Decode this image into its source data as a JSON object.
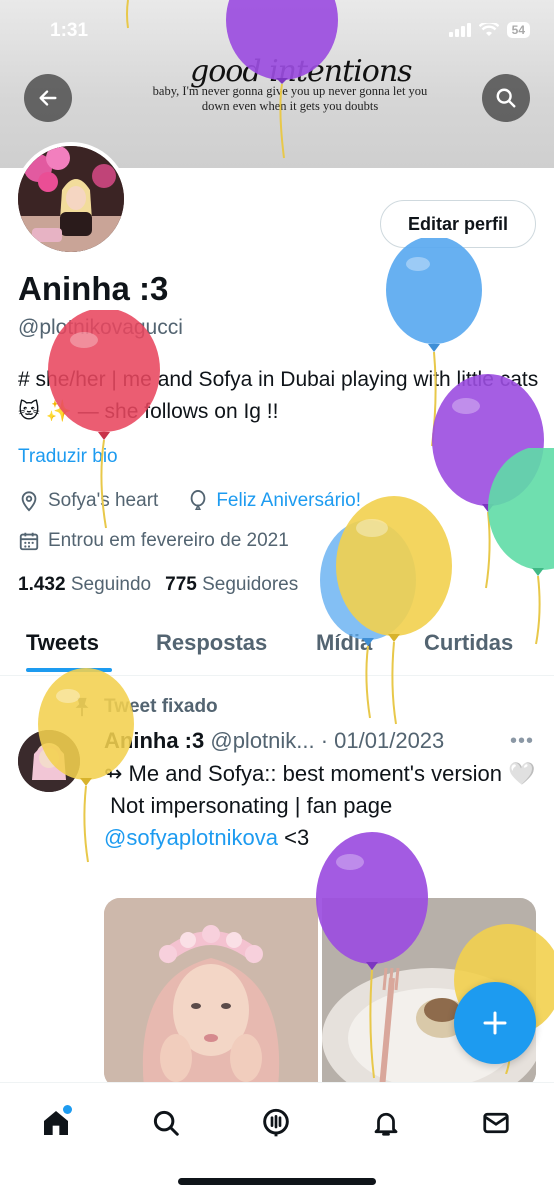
{
  "status_bar": {
    "time": "1:31",
    "battery": "54"
  },
  "banner": {
    "script_text": "good intentions",
    "lyric": "baby, I'm never gonna give you up never gonna let you down even when it gets you doubts"
  },
  "profile": {
    "edit_button": "Editar perfil",
    "name": "Aninha :3",
    "handle": "@plotnikovagucci",
    "bio": "# she/her | me and Sofya in Dubai playing with little cats 🐱 ✨ — she follows on Ig !!",
    "translate": "Traduzir bio",
    "location": "Sofya's heart",
    "birthday": "Feliz Aniversário!",
    "joined": "Entrou em fevereiro de 2021",
    "following_count": "1.432",
    "following_label": "Seguindo",
    "followers_count": "775",
    "followers_label": "Seguidores"
  },
  "tabs": [
    "Tweets",
    "Respostas",
    "Mídia",
    "Curtidas"
  ],
  "tweet": {
    "pinned_label": "Tweet fixado",
    "author": "Aninha :3",
    "handle_date": "@plotnik... · 01/01/2023",
    "more": "•••",
    "line1": "↬ Me and Sofya:: best moment's version 🤍",
    "line2": " Not impersonating | fan page",
    "mention": "@sofyaplotnikova",
    "tail": " <3"
  },
  "colors": {
    "accent": "#1d9bf0",
    "balloon_red": "#e8475f",
    "balloon_blue": "#5aa9f0",
    "balloon_purple": "#9b4de0",
    "balloon_yellow": "#f2d04e",
    "balloon_green": "#5fdca6"
  },
  "icons": {
    "back": "arrow-left-icon",
    "search": "search-icon",
    "location": "location-pin-icon",
    "birthday": "balloon-icon",
    "calendar": "calendar-icon",
    "pin": "pin-icon",
    "compose": "plus-icon",
    "nav": [
      "home-icon",
      "search-icon",
      "spaces-icon",
      "bell-icon",
      "mail-icon"
    ]
  }
}
